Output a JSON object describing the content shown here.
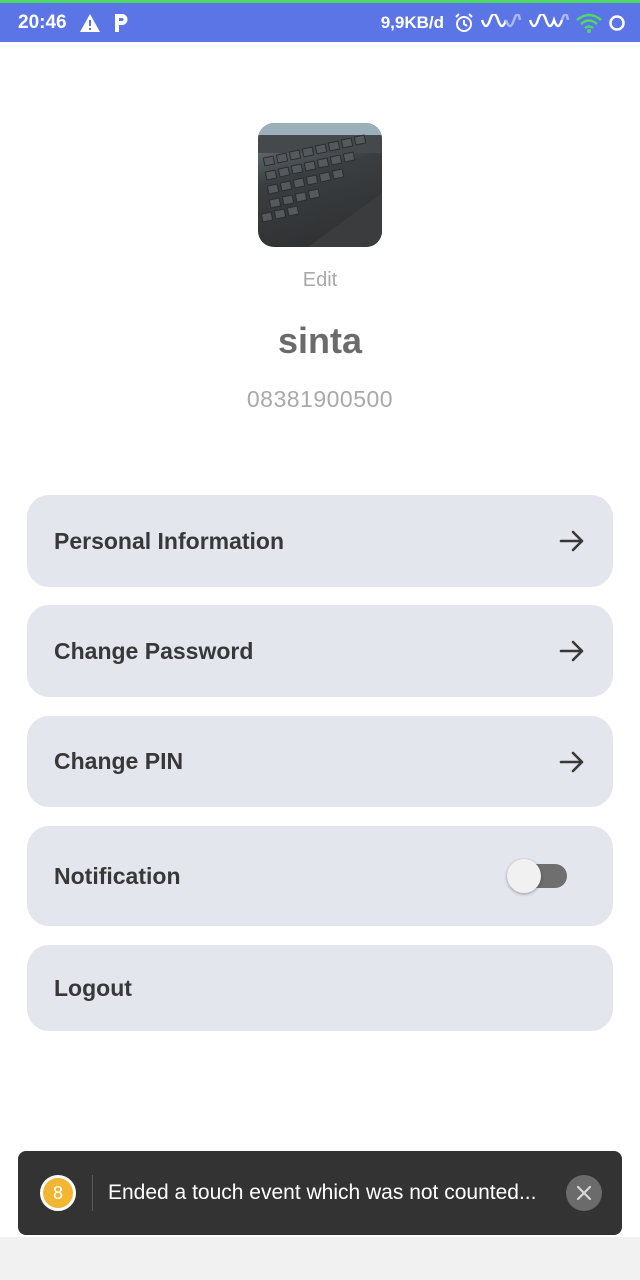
{
  "status_bar": {
    "time": "20:46",
    "network_speed": "9,9KB/d",
    "icons": [
      "warning-icon",
      "parking-icon",
      "alarm-icon",
      "signal-wave-icon",
      "signal-wave-icon",
      "wifi-icon",
      "circle-icon"
    ]
  },
  "profile": {
    "avatar_icon": "keyboard-photo",
    "edit_label": "Edit",
    "name": "sinta",
    "phone": "08381900500"
  },
  "menu": {
    "personal_information": "Personal Information",
    "change_password": "Change Password",
    "change_pin": "Change PIN",
    "notification": "Notification",
    "notification_enabled": false,
    "logout": "Logout"
  },
  "toast": {
    "badge": "8",
    "message": "Ended a touch event which was not counted...",
    "close_icon": "close-icon"
  },
  "colors": {
    "status_bar": "#5b75e6",
    "menu_background": "#e4e6ee",
    "toast_background": "#333333",
    "badge": "#f3b632"
  }
}
